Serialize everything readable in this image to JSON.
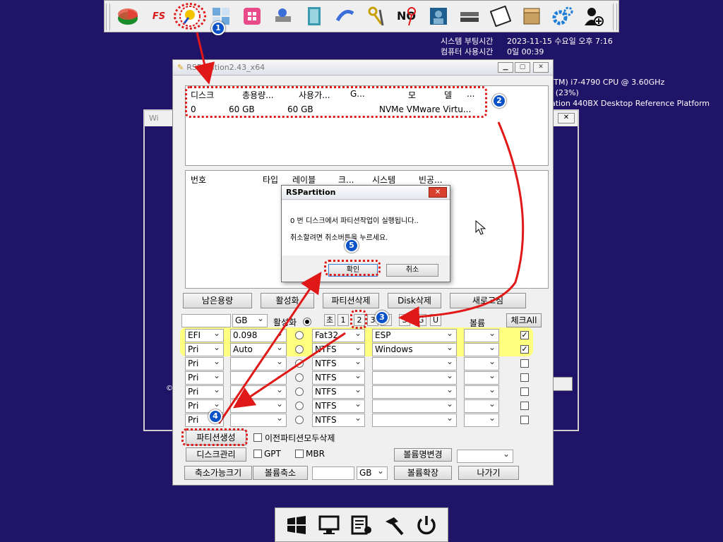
{
  "toolbar": {
    "icons": [
      "partition-tool-icon",
      "fs-tool-icon",
      "rspartition-icon",
      "windows-tiles-icon",
      "windows-store-icon",
      "network-drive-icon",
      "notebook-icon",
      "link-tool-icon",
      "keys-icon",
      "no-tool-icon",
      "user-photo-icon",
      "keyboard-icon",
      "floppy-disk-icon",
      "package-box-icon",
      "gears-icon",
      "user-add-icon"
    ],
    "fs_label": "FS"
  },
  "sysinfo": {
    "boot_label": "시스템 부팅시간",
    "boot_value": "2023-11-15 수요일 오후 7:16",
    "uptime_label": "컴퓨터 사용시간",
    "uptime_value": "0일 00:39",
    "cpu": "(TM) i7-4790 CPU @ 3.60GHz",
    "usage": "I (23%)",
    "board": "ation 440BX Desktop Reference Platform"
  },
  "back_window": {
    "title": "Wi",
    "close": "✕",
    "copyright": "©"
  },
  "main_window": {
    "title": "RSPartition2.43_x64",
    "disk_table": {
      "headers": [
        "디스크",
        "총용량...",
        "사용가...",
        "G...",
        "모",
        "델",
        "..."
      ],
      "row": [
        "0",
        "60 GB",
        "60 GB",
        "NVMe VMware Virtu..."
      ]
    },
    "part_table": {
      "headers": [
        "번호",
        "타입",
        "레이블",
        "크...",
        "시스템",
        "빈공..."
      ]
    },
    "buttons": {
      "remaining": "남은용량",
      "activate": "활성화",
      "delete_part": "파티션삭제",
      "delete_disk": "Disk삭제",
      "refresh": "새로고침"
    },
    "size_unit": "GB",
    "active_label": "활성화",
    "quick_buttons": [
      "초",
      "1",
      "2",
      "3",
      "4",
      "S",
      "G",
      "U"
    ],
    "volume_label": "볼륨",
    "check_all": "체크All",
    "rows": [
      {
        "type": "EFI",
        "size": "0.098",
        "fs": "Fat32",
        "label": "ESP",
        "checked": true
      },
      {
        "type": "Pri",
        "size": "Auto",
        "fs": "NTFS",
        "label": "Windows",
        "checked": true
      },
      {
        "type": "Pri",
        "size": "",
        "fs": "NTFS",
        "label": "",
        "checked": false
      },
      {
        "type": "Pri",
        "size": "",
        "fs": "NTFS",
        "label": "",
        "checked": false
      },
      {
        "type": "Pri",
        "size": "",
        "fs": "NTFS",
        "label": "",
        "checked": false
      },
      {
        "type": "Pri",
        "size": "",
        "fs": "NTFS",
        "label": "",
        "checked": false
      },
      {
        "type": "Pri",
        "size": "",
        "fs": "NTFS",
        "label": "",
        "checked": false
      }
    ],
    "create_partition": "파티션생성",
    "delete_all_prev": "이전파티션모두삭제",
    "disk_manage": "디스크관리",
    "gpt": "GPT",
    "mbr": "MBR",
    "volume_rename": "볼륨명변경",
    "shrinkable_size": "축소가능크기",
    "volume_shrink": "볼륨축소",
    "shrink_unit": "GB",
    "volume_extend": "볼륨확장",
    "exit": "나가기"
  },
  "dialog": {
    "title": "RSPartition",
    "line1": "0 번 디스크에서 파티션작업이 실행됩니다..",
    "line2": "취소할려면 취소버튼을 누르세요.",
    "ok": "확인",
    "cancel": "취소"
  },
  "badges": [
    "1",
    "2",
    "3",
    "4",
    "5"
  ],
  "bottom": {
    "icons": [
      "windows-logo-icon",
      "monitor-settings-icon",
      "task-list-icon",
      "hammer-icon",
      "power-icon"
    ]
  },
  "colors": {
    "desktop": "#201468",
    "highlight": "#ffff80",
    "annotation": "#e01818",
    "badge": "#0a52c7"
  }
}
